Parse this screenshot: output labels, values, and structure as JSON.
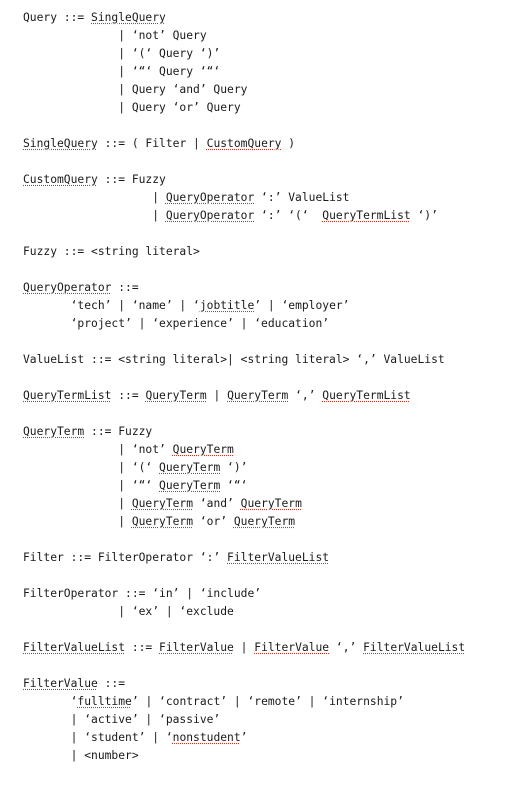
{
  "document": {
    "lines": [
      [
        {
          "t": "Query ::= "
        },
        {
          "t": "SingleQuery",
          "u": true
        }
      ],
      [
        {
          "t": "              | ‘not’ Query"
        }
      ],
      [
        {
          "t": "              | ‘(‘ Query ‘)’"
        }
      ],
      [
        {
          "t": "              | ‘“‘ Query ‘“‘"
        }
      ],
      [
        {
          "t": "              | Query ‘and’ Query"
        }
      ],
      [
        {
          "t": "              | Query ‘or’ Query"
        }
      ],
      [],
      [
        {
          "t": "SingleQuery",
          "u": true
        },
        {
          "t": " ::= ( Filter | "
        },
        {
          "t": "CustomQuery",
          "u": true
        },
        {
          "t": " )"
        }
      ],
      [],
      [
        {
          "t": "CustomQuery",
          "u": true
        },
        {
          "t": " ::= Fuzzy"
        }
      ],
      [
        {
          "t": "                   | "
        },
        {
          "t": "QueryOperator",
          "u": true
        },
        {
          "t": " ‘:’ ValueList"
        }
      ],
      [
        {
          "t": "                   | "
        },
        {
          "t": "QueryOperator",
          "u": true
        },
        {
          "t": " ‘:’ ‘(‘  "
        },
        {
          "t": "QueryTermList",
          "u": true
        },
        {
          "t": " ‘)’"
        }
      ],
      [],
      [
        {
          "t": "Fuzzy ::= <string literal>"
        }
      ],
      [],
      [
        {
          "t": "QueryOperator",
          "u": true
        },
        {
          "t": " ::="
        }
      ],
      [
        {
          "t": "       ‘tech’ | ‘name’ | ‘"
        },
        {
          "t": "jobtitle",
          "u": true
        },
        {
          "t": "’ | ‘employer’"
        }
      ],
      [
        {
          "t": "       ‘project’ | ‘experience’ | ‘education’"
        }
      ],
      [],
      [
        {
          "t": "ValueList ::= <string literal>| <string literal> ‘,’ ValueList"
        }
      ],
      [],
      [
        {
          "t": "QueryTermList",
          "u": true
        },
        {
          "t": " ::= "
        },
        {
          "t": "QueryTerm",
          "u": true
        },
        {
          "t": " | "
        },
        {
          "t": "QueryTerm",
          "u": true
        },
        {
          "t": " ‘,’ "
        },
        {
          "t": "QueryTermList",
          "u": true
        }
      ],
      [],
      [
        {
          "t": "QueryTerm",
          "u": true
        },
        {
          "t": " ::= Fuzzy"
        }
      ],
      [
        {
          "t": "              | ‘not’ "
        },
        {
          "t": "QueryTerm",
          "u": true
        }
      ],
      [
        {
          "t": "              | ‘(‘ "
        },
        {
          "t": "QueryTerm",
          "u": true
        },
        {
          "t": " ‘)’"
        }
      ],
      [
        {
          "t": "              | ‘“‘ "
        },
        {
          "t": "QueryTerm",
          "u": true
        },
        {
          "t": " ‘“‘"
        }
      ],
      [
        {
          "t": "              | "
        },
        {
          "t": "QueryTerm",
          "u": true
        },
        {
          "t": " ‘and’ "
        },
        {
          "t": "QueryTerm",
          "u": true
        }
      ],
      [
        {
          "t": "              | "
        },
        {
          "t": "QueryTerm",
          "u": true
        },
        {
          "t": " ‘or’ "
        },
        {
          "t": "QueryTerm",
          "u": true
        }
      ],
      [],
      [
        {
          "t": "Filter ::= FilterOperator ‘:’ "
        },
        {
          "t": "FilterValueList",
          "u": true
        }
      ],
      [],
      [
        {
          "t": "FilterOperator ::= ‘in’ | ‘include’"
        }
      ],
      [
        {
          "t": "              | ‘ex’ | ‘exclude"
        }
      ],
      [],
      [
        {
          "t": "FilterValueList",
          "u": true
        },
        {
          "t": " ::= "
        },
        {
          "t": "FilterValue",
          "u": true
        },
        {
          "t": " | "
        },
        {
          "t": "FilterValue",
          "u": true
        },
        {
          "t": " ‘,’ "
        },
        {
          "t": "FilterValueList",
          "u": true
        }
      ],
      [],
      [
        {
          "t": "FilterValue",
          "u": true
        },
        {
          "t": " ::="
        }
      ],
      [
        {
          "t": "       ‘"
        },
        {
          "t": "fulltime",
          "u": true
        },
        {
          "t": "’ | ‘contract’ | ‘remote’ | ‘internship’"
        }
      ],
      [
        {
          "t": "       | ‘active’ | ‘passive’"
        }
      ],
      [
        {
          "t": "       | ‘student’ | ‘"
        },
        {
          "t": "nonstudent",
          "u": true
        },
        {
          "t": "’"
        }
      ],
      [
        {
          "t": "       | <number>"
        }
      ]
    ]
  }
}
